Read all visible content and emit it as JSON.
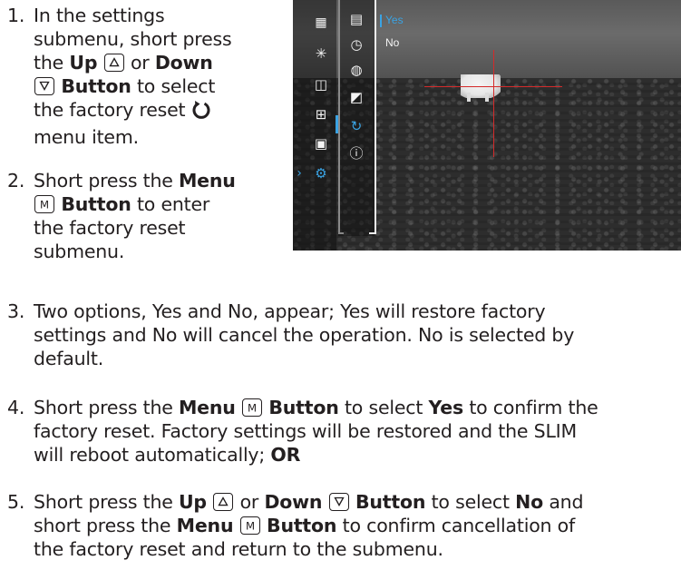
{
  "steps": [
    {
      "num": "1.",
      "line1": "In the settings",
      "line2": "submenu, short press",
      "the": "the",
      "up": "Up",
      "or": "or",
      "down": "Down",
      "button": "Button",
      "to_select": "to select",
      "line5": "the factory reset",
      "line6": "menu item."
    },
    {
      "num": "2.",
      "short_press": "Short press the",
      "menu": "Menu",
      "button": "Button",
      "to_enter": "to enter",
      "line3": "the factory reset",
      "line4": "submenu."
    },
    {
      "num": "3.",
      "line1": "Two options, Yes and No, appear; Yes will restore factory",
      "line2": "settings and No will cancel the operation. No is selected by",
      "line3": "default."
    },
    {
      "num": "4.",
      "pre": "Short press the",
      "menu": "Menu",
      "button": "Button",
      "to_select": "to select",
      "yes": "Yes",
      "confirm": "to confirm the",
      "line2": "factory reset. Factory settings will be restored and the SLIM",
      "line3a": "will reboot automatically;",
      "or_bold": "OR"
    },
    {
      "num": "5.",
      "pre": "Short press the",
      "up": "Up",
      "or": "or",
      "down": "Down",
      "button": "Button",
      "to_select": "to select",
      "no": "No",
      "and": "and",
      "line2a": "short press the",
      "menu": "Menu",
      "line2b": "to confirm cancellation of",
      "line3": "the factory reset and return to the submenu."
    }
  ],
  "screenshot": {
    "options": [
      "Yes",
      "No"
    ],
    "selected_option": "Yes",
    "accent_color": "#3aa3e3",
    "crosshair_color": "#d42a2a",
    "main_menu_icons": [
      "image-mode-icon",
      "brightness-icon",
      "screen-off-icon",
      "zoom-icon",
      "picture-in-picture-icon",
      "settings-icon"
    ],
    "sub_menu_icons": [
      "calendar-icon",
      "clock-icon",
      "language-globe-icon",
      "units-icon",
      "factory-reset-icon",
      "info-icon"
    ]
  }
}
